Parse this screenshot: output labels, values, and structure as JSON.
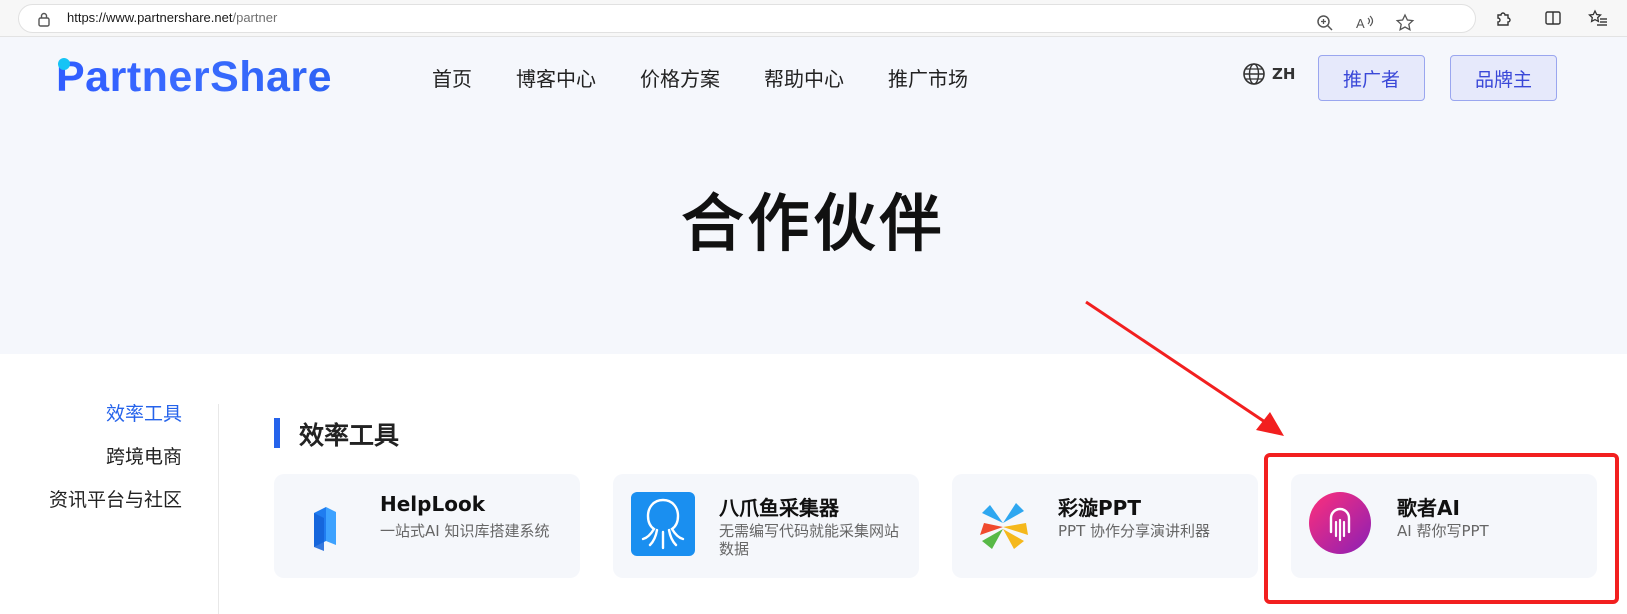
{
  "browser": {
    "url_host": "https://www.partnershare.net",
    "url_path": "/partner"
  },
  "header": {
    "logo": "PartnerShare",
    "nav": [
      "首页",
      "博客中心",
      "价格方案",
      "帮助中心",
      "推广市场"
    ],
    "lang": "ZH",
    "promoter_button": "推广者",
    "brand_button": "品牌主"
  },
  "hero": {
    "title": "合作伙伴"
  },
  "sidebar": {
    "items": [
      {
        "label": "效率工具",
        "active": true
      },
      {
        "label": "跨境电商",
        "active": false
      },
      {
        "label": "资讯平台与社区",
        "active": false
      }
    ]
  },
  "section": {
    "title": "效率工具"
  },
  "cards": [
    {
      "name": "HelpLook",
      "desc": "一站式AI 知识库搭建系统",
      "icon": "helplook-logo-icon"
    },
    {
      "name": "八爪鱼采集器",
      "desc": "无需编写代码就能采集网站数据",
      "icon": "octopus-logo-icon"
    },
    {
      "name": "彩漩PPT",
      "desc": "PPT 协作分享演讲利器",
      "icon": "caixuan-logo-icon"
    },
    {
      "name": "歌者AI",
      "desc": "AI 帮你写PPT",
      "icon": "gezhe-logo-icon"
    }
  ],
  "colors": {
    "accent": "#2563eb",
    "annotation": "#f21f1f",
    "hero_bg": "#f5f7fc"
  }
}
